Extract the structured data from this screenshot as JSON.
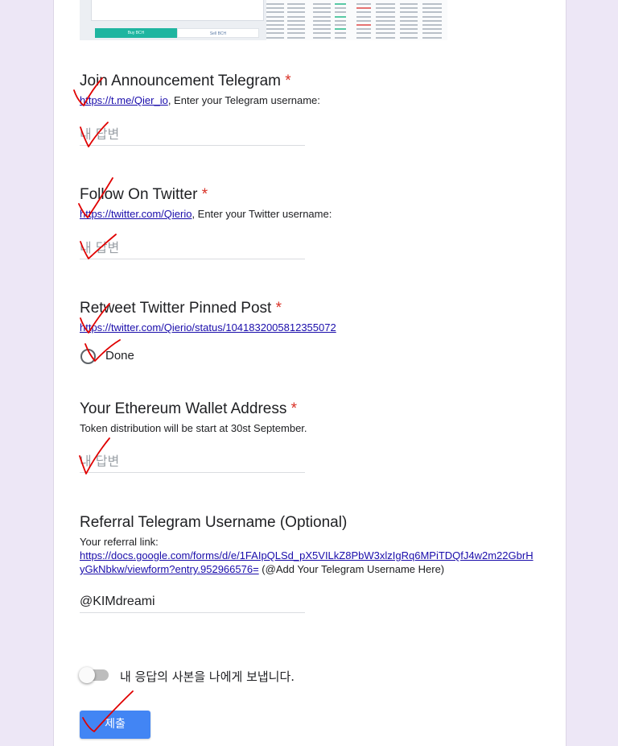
{
  "screenshot": {
    "buy_label": "Buy BCH",
    "sell_label": "Sell BCH"
  },
  "q1": {
    "title": "Join Announcement Telegram",
    "required_mark": "*",
    "link": "https://t.me/Qier_io",
    "desc_rest": ", Enter your Telegram username:",
    "placeholder": "내 답변"
  },
  "q2": {
    "title": "Follow On Twitter",
    "required_mark": "*",
    "link": "https://twitter.com/Qierio",
    "desc_rest": ", Enter your Twitter username:",
    "placeholder": "내 답변"
  },
  "q3": {
    "title": "Retweet Twitter Pinned Post",
    "required_mark": "*",
    "link": "https://twitter.com/Qierio/status/1041832005812355072",
    "option": "Done"
  },
  "q4": {
    "title": "Your Ethereum Wallet Address",
    "required_mark": "*",
    "desc": "Token distribution will be start at 30st September.",
    "placeholder": "내 답변"
  },
  "q5": {
    "title": "Referral Telegram Username (Optional)",
    "desc_line1": "Your referral link:",
    "link_line1": "https://docs.google.com/forms/d/e/1FAIpQLSd_pX5VILkZ8PbW3xlzIgRq6MPiTDQfJ4w2m22GbrH",
    "link_line2": "yGkNbkw/viewform?entry.952966576=",
    "desc_rest": " (@Add Your Telegram Username Here)",
    "value": "@KIMdreami"
  },
  "copy_toggle": {
    "label": "내 응답의 사본을 나에게 보냅니다.",
    "on": false
  },
  "submit": {
    "label": "제출"
  },
  "colors": {
    "accent": "#4285f4",
    "required": "#d93025",
    "link": "#1a0dab",
    "checkmark": "#e00000"
  }
}
